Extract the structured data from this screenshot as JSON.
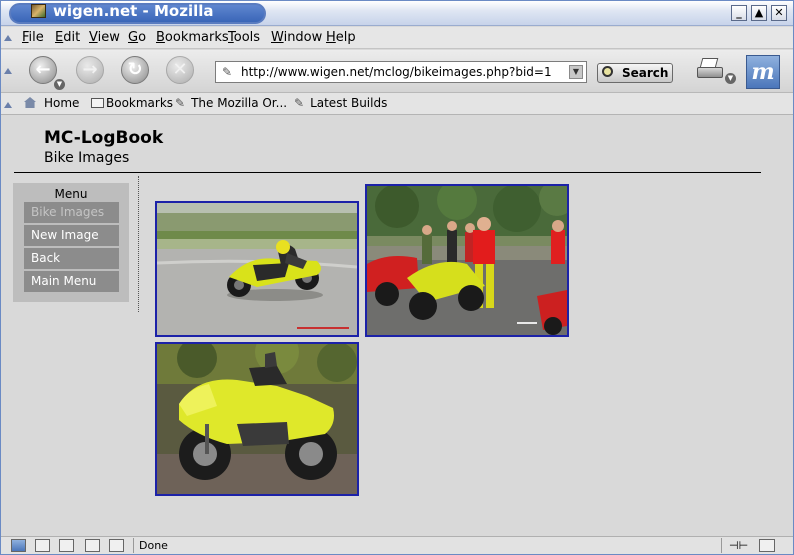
{
  "window": {
    "title": "wigen.net - Mozilla",
    "controls": {
      "minimize": "_",
      "maximize": "▲",
      "close": "✕"
    }
  },
  "menubar": {
    "items": [
      {
        "key": "F",
        "rest": "ile"
      },
      {
        "key": "E",
        "rest": "dit"
      },
      {
        "key": "V",
        "rest": "iew"
      },
      {
        "key": "G",
        "rest": "o"
      },
      {
        "key": "B",
        "rest": "ookmarks"
      },
      {
        "key": "T",
        "rest": "ools"
      },
      {
        "key": "W",
        "rest": "indow"
      },
      {
        "key": "H",
        "rest": "elp"
      }
    ]
  },
  "navbar": {
    "url": "http://www.wigen.net/mclog/bikeimages.php?bid=1",
    "search_label": "Search",
    "back_glyph": "←",
    "forward_glyph": "→",
    "reload_glyph": "↻",
    "stop_glyph": "✕",
    "logo_glyph": "m"
  },
  "personal_toolbar": {
    "home": "Home",
    "bookmarks": "Bookmarks",
    "link1": "The Mozilla Or...",
    "link2": "Latest Builds"
  },
  "page": {
    "title": "MC-LogBook",
    "subtitle": "Bike Images",
    "menu_title": "Menu",
    "menu_items": [
      "Bike Images",
      "New Image",
      "Back",
      "Main Menu"
    ],
    "colors": {
      "photo_border": "#1c22a8",
      "menu_bg": "#bdbdbd",
      "menu_link_bg": "#8c8c8c"
    }
  },
  "status": {
    "text": "Done"
  }
}
